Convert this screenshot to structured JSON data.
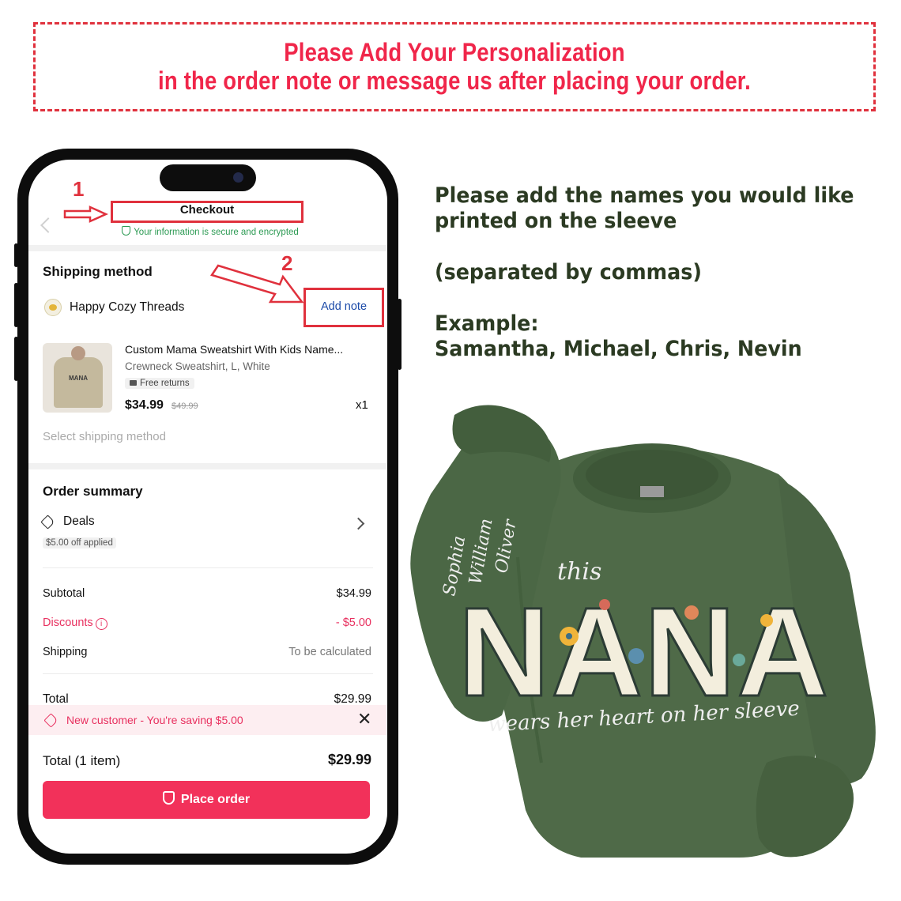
{
  "banner": {
    "line1": "Please Add Your Personalization",
    "line2": "in the order note or message us after placing your order."
  },
  "steps": {
    "one": "1",
    "two": "2"
  },
  "checkout": {
    "title": "Checkout",
    "secure_text": "Your information is secure and encrypted"
  },
  "shipping": {
    "section_title": "Shipping method",
    "shop_name": "Happy Cozy Threads",
    "add_note": "Add note",
    "product": {
      "name": "Custom Mama Sweatshirt With Kids Name...",
      "variant": "Crewneck Sweatshirt, L, White",
      "badge": "Free returns",
      "price": "$34.99",
      "original_price": "$49.99",
      "quantity": "x1",
      "image_label": "MANA"
    },
    "select_method": "Select shipping method"
  },
  "order_summary": {
    "title": "Order summary",
    "deals_label": "Deals",
    "deals_badge": "$5.00 off applied",
    "subtotal_label": "Subtotal",
    "subtotal_value": "$34.99",
    "discounts_label": "Discounts",
    "discounts_value": "- $5.00",
    "shipping_label": "Shipping",
    "shipping_value": "To be calculated",
    "total_label": "Total",
    "total_value": "$29.99"
  },
  "banner_new_customer": "New customer - You're saving $5.00",
  "footer": {
    "total_label": "Total (1 item)",
    "total_value": "$29.99",
    "place_order": "Place order"
  },
  "instructions": {
    "line1": "Please add the names you would like",
    "line2": "printed on the sleeve",
    "line3": "(separated by commas)",
    "line4": "Example:",
    "line5": "Samantha, Michael, Chris, Nevin"
  },
  "sweatshirt": {
    "small_word": "this",
    "big_word": "NANA",
    "tagline": "wears her heart on her sleeve",
    "sleeve_names": [
      "Sophia",
      "William",
      "Oliver"
    ]
  },
  "colors": {
    "accent_red": "#e0313d",
    "banner_text": "#f0264a",
    "tiktok_pink": "#f2315a",
    "secure_green": "#2c9a53",
    "instructions_text": "#2b3a22",
    "shirt_green": "#4f6a48"
  }
}
